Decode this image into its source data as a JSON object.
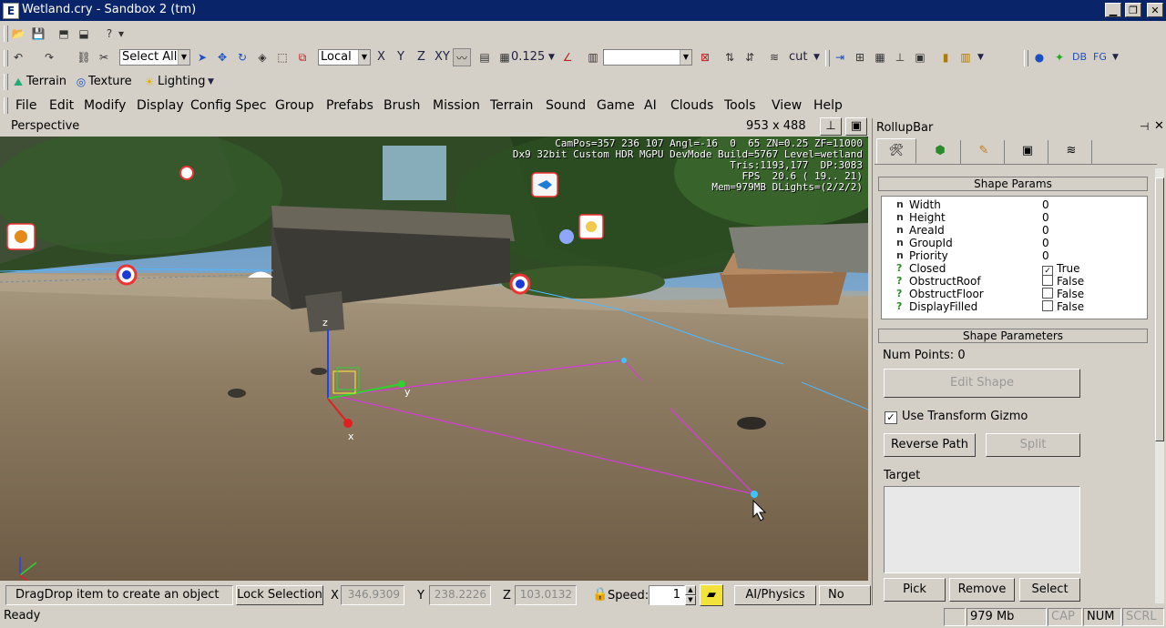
{
  "window": {
    "title": "Wetland.cry - Sandbox 2 (tm)",
    "app_icon": "E"
  },
  "toolbar2": {
    "select_all": "Select All",
    "coord_system": "Local",
    "axis_x": "X",
    "axis_y": "Y",
    "axis_z": "Z",
    "axis_xy": "XY",
    "grid_size": "0.125",
    "layer_combo": "",
    "layer_name": "cut",
    "db_label": "DB",
    "fg_label": "FG"
  },
  "toolbar3": {
    "terrain": "Terrain",
    "texture": "Texture",
    "lighting": "Lighting"
  },
  "menu": [
    "File",
    "Edit",
    "Modify",
    "Display",
    "Config Spec",
    "Group",
    "Prefabs",
    "Brush",
    "Mission",
    "Terrain",
    "Sound",
    "Game",
    "AI",
    "Clouds",
    "Tools",
    "View",
    "Help"
  ],
  "viewport": {
    "name": "Perspective",
    "resolution": "953 x 488",
    "hud_lines": [
      "CamPos=357 236 107 Angl=-16  0  65 ZN=0.25 ZF=11000",
      "Dx9 32bit Custom HDR MGPU DevMode Build=5767 Level=wetland",
      "Tris:1193,177  DP:3083",
      "FPS  20.6 ( 19.. 21)",
      "Mem=979MB DLights=(2/2/2)"
    ],
    "gizmo_labels": {
      "z": "z",
      "y": "y",
      "x": "x"
    }
  },
  "bottom": {
    "hint": "DragDrop item to create an object",
    "lock_selection": "Lock Selection",
    "x_label": "X",
    "x_value": "346.9309",
    "y_label": "Y",
    "y_value": "238.2226",
    "z_label": "Z",
    "z_value": "103.0132",
    "speed_label": "Speed:",
    "speed_value": "1",
    "ai_physics": "AI/Physics",
    "no_sync": "No Sync"
  },
  "status": {
    "ready": "Ready",
    "memory": "979 Mb",
    "cap": "CAP",
    "num": "NUM",
    "scrl": "SCRL"
  },
  "rollup": {
    "title": "RollupBar",
    "shape_params_header": "Shape Params",
    "props": [
      {
        "icon": "n",
        "name": "Width",
        "value": "0",
        "check": ""
      },
      {
        "icon": "n",
        "name": "Height",
        "value": "0",
        "check": ""
      },
      {
        "icon": "n",
        "name": "AreaId",
        "value": "0",
        "check": ""
      },
      {
        "icon": "n",
        "name": "GroupId",
        "value": "0",
        "check": ""
      },
      {
        "icon": "n",
        "name": "Priority",
        "value": "0",
        "check": ""
      },
      {
        "icon": "?",
        "name": "Closed",
        "value": "True",
        "check": "✓"
      },
      {
        "icon": "?",
        "name": "ObstructRoof",
        "value": "False",
        "check": " "
      },
      {
        "icon": "?",
        "name": "ObstructFloor",
        "value": "False",
        "check": " "
      },
      {
        "icon": "?",
        "name": "DisplayFilled",
        "value": "False",
        "check": " "
      }
    ],
    "shape_parameters_header": "Shape Parameters",
    "num_points": "Num Points: 0",
    "edit_shape": "Edit Shape",
    "use_transform_gizmo": "Use Transform Gizmo",
    "reverse_path": "Reverse Path",
    "split": "Split",
    "target_label": "Target",
    "pick": "Pick",
    "remove": "Remove",
    "select": "Select"
  }
}
